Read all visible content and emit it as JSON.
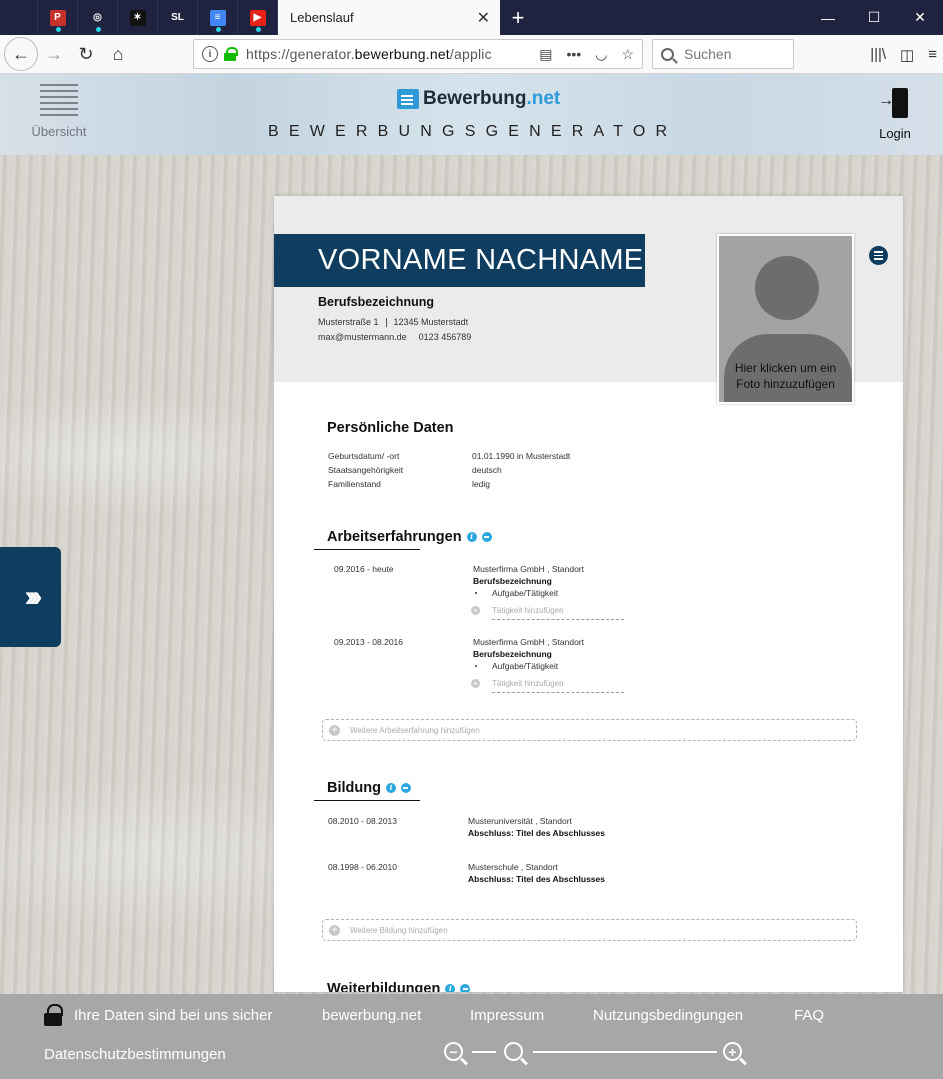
{
  "browser": {
    "pinned_tabs": [
      {
        "name": "pinned-tab-p",
        "glyph": "P",
        "color": "#c6312b",
        "playing": true
      },
      {
        "name": "pinned-tab-globe",
        "glyph": "◎",
        "color": "#202340",
        "playing": true
      },
      {
        "name": "pinned-tab-dark",
        "glyph": "✶",
        "color": "#111111",
        "playing": false
      },
      {
        "name": "pinned-tab-sl",
        "glyph": "SL",
        "color": "#202340",
        "playing": false
      },
      {
        "name": "pinned-tab-docs",
        "glyph": "≡",
        "color": "#4285f4",
        "playing": true
      },
      {
        "name": "pinned-tab-youtube",
        "glyph": "▶",
        "color": "#e62117",
        "playing": true
      }
    ],
    "active_tab_title": "Lebenslauf",
    "url_prefix": "https://generator.",
    "url_domain": "bewerbung.net",
    "url_suffix": "/applic",
    "search_placeholder": "Suchen"
  },
  "site": {
    "overview_label": "Übersicht",
    "logo_name": "Bewerbung",
    "logo_tld": ".net",
    "generator_title": "BEWERBUNGSGENERATOR",
    "login_label": "Login"
  },
  "cv": {
    "name": "VORNAME NACHNAME",
    "job_title": "Berufsbezeichnung",
    "street": "Musterstraße 1",
    "city": "12345 Musterstadt",
    "email": "max@mustermann.de",
    "phone": "0123 456789",
    "photo_hint_1": "Hier klicken um ein",
    "photo_hint_2": "Foto hinzuzufügen",
    "personal": {
      "title": "Persönliche Daten",
      "rows": [
        {
          "label": "Geburtsdatum/ -ort",
          "value": "01.01.1990 in Musterstadt"
        },
        {
          "label": "Staatsangehörigkeit",
          "value": "deutsch"
        },
        {
          "label": "Familienstand",
          "value": "ledig"
        }
      ]
    },
    "work": {
      "title": "Arbeitserfahrungen",
      "info_icon": "i",
      "entries": [
        {
          "date": "09.2016 - heute",
          "company": "Musterfirma GmbH , Standort",
          "role": "Berufsbezeichnung",
          "task": "Aufgabe/Tätigkeit",
          "add_task": "Tätigkeit hinzufügen"
        },
        {
          "date": "09.2013 - 08.2016",
          "company": "Musterfirma GmbH , Standort",
          "role": "Berufsbezeichnung",
          "task": "Aufgabe/Tätigkeit",
          "add_task": "Tätigkeit hinzufügen"
        }
      ],
      "add_more": "Weitere Arbeitserfahrung hinzufügen"
    },
    "education": {
      "title": "Bildung",
      "info_icon": "i",
      "entries": [
        {
          "date": "08.2010 - 08.2013",
          "school": "Musteruniversität , Standort",
          "degree": "Abschluss: Titel des Abschlusses"
        },
        {
          "date": "08.1998 - 06.2010",
          "school": "Musterschule , Standort",
          "degree": "Abschluss: Titel des Abschlusses"
        }
      ],
      "add_more": "Weitere Bildung hinzufügen"
    },
    "further": {
      "title": "Weiterbildungen",
      "info_icon": "i"
    }
  },
  "footer": {
    "secure_label": "Ihre Daten sind bei uns sicher",
    "links": [
      "bewerbung.net",
      "Impressum",
      "Nutzungsbedingungen",
      "FAQ"
    ],
    "privacy": "Datenschutzbestimmungen",
    "zoom_out_glyph": "−",
    "zoom_in_glyph": "+"
  },
  "colors": {
    "brand_navy": "#0f3d5f",
    "accent_blue": "#2aa8dd",
    "footer_gray": "#a7a7a7"
  }
}
